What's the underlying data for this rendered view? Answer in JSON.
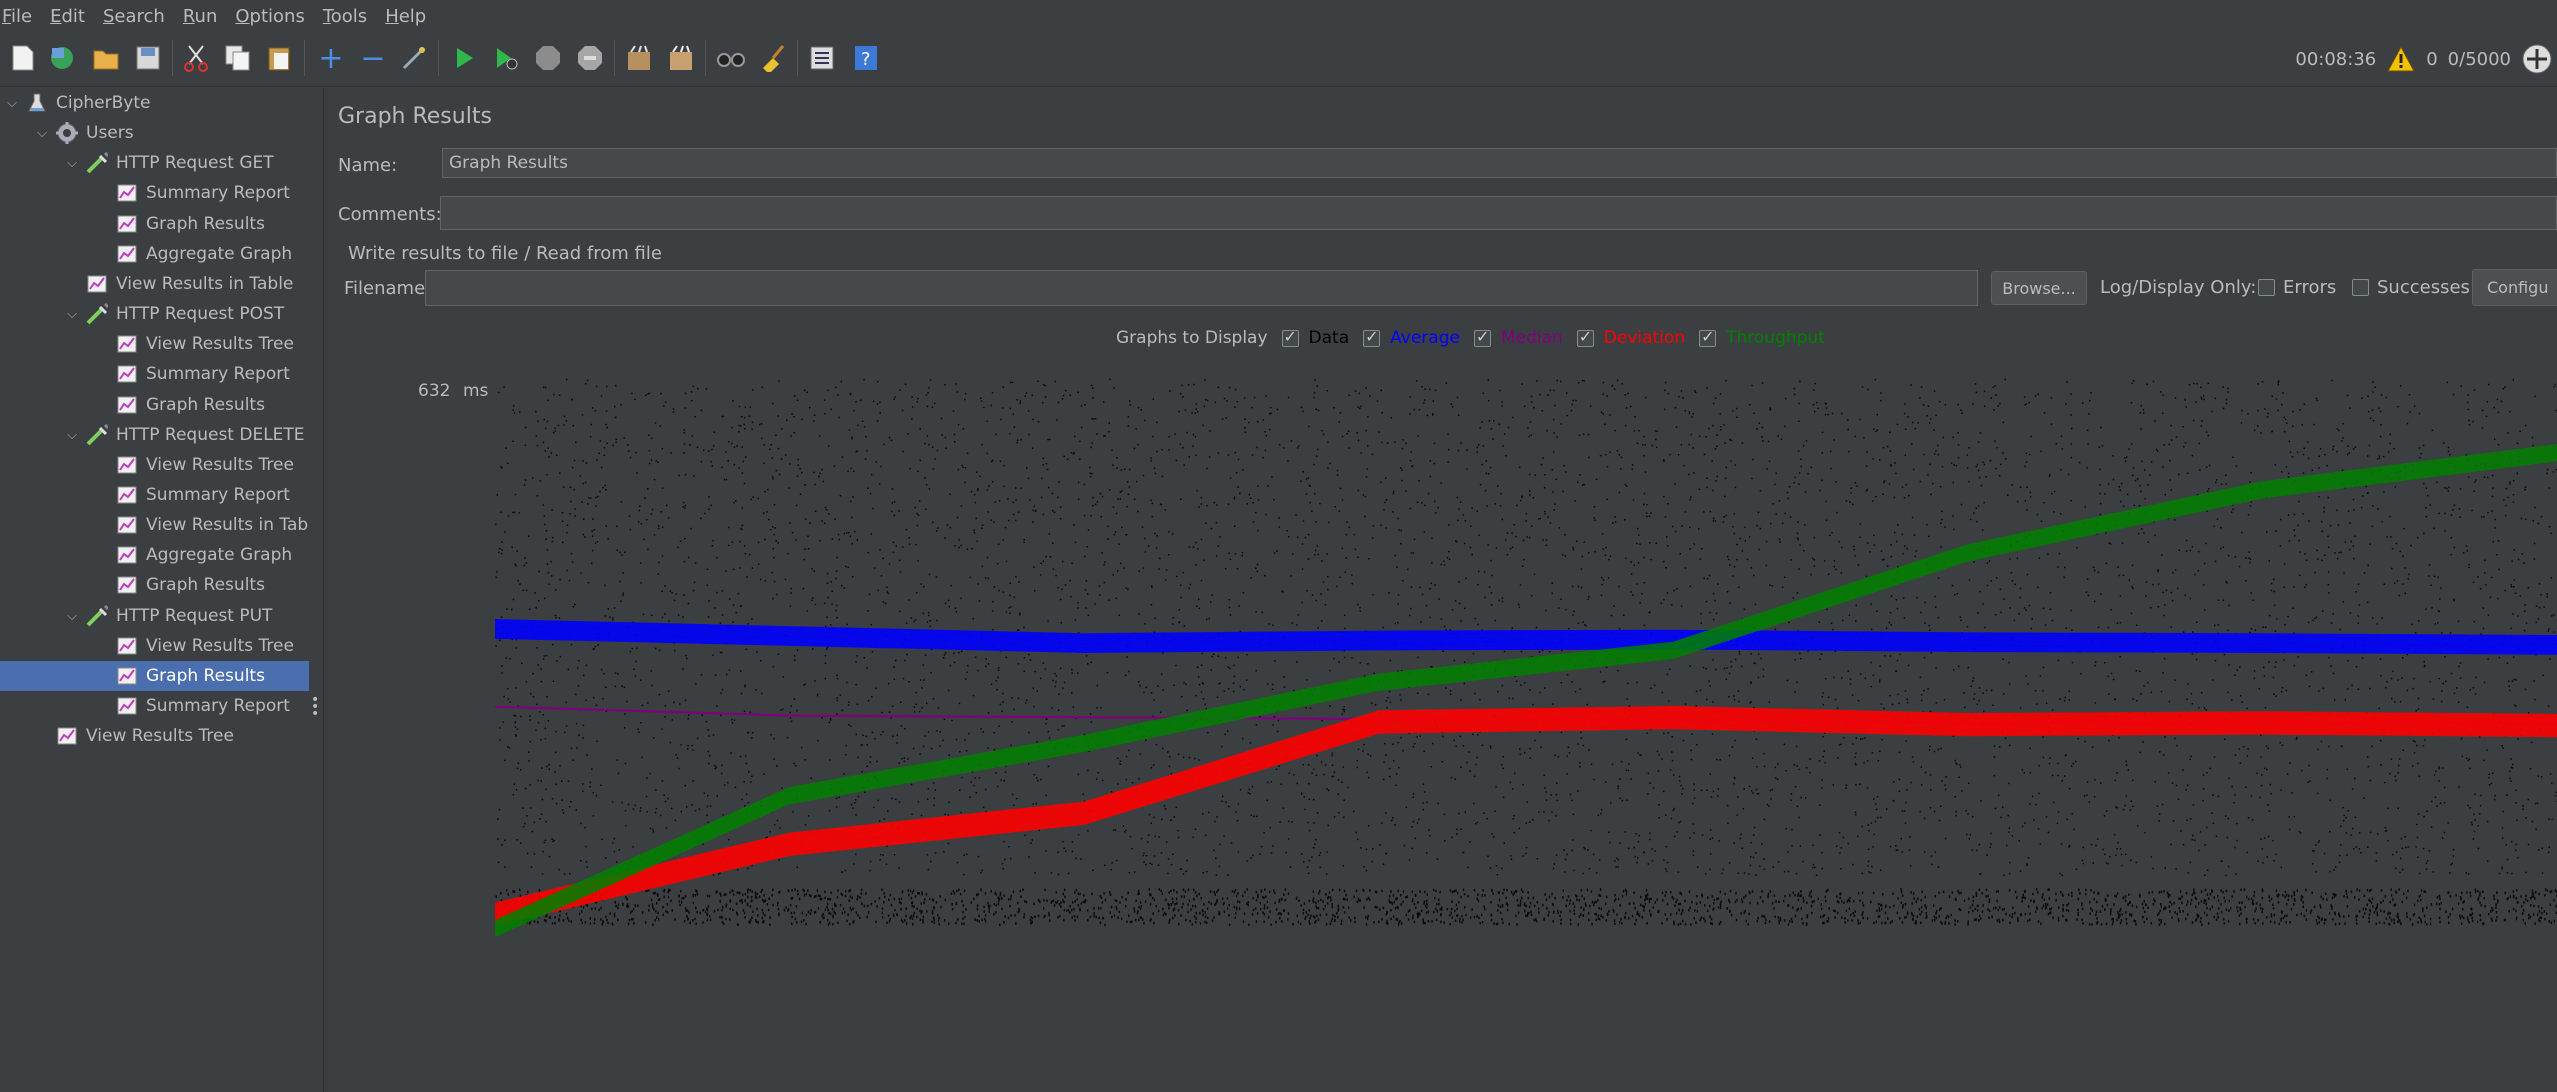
{
  "menu": [
    "File",
    "Edit",
    "Search",
    "Run",
    "Options",
    "Tools",
    "Help"
  ],
  "toolbar": {
    "elapsed": "00:08:36",
    "error_count": "0",
    "threads": "0/5000"
  },
  "tree": [
    {
      "label": "CipherByte",
      "icon": "test-plan-icon",
      "expanded": true
    },
    {
      "label": "Users",
      "icon": "thread-group-icon",
      "expanded": true
    },
    {
      "label": "HTTP Request GET",
      "icon": "sampler-icon",
      "expanded": true
    },
    {
      "label": "Summary Report",
      "icon": "listener-icon"
    },
    {
      "label": "Graph Results",
      "icon": "listener-icon"
    },
    {
      "label": "Aggregate Graph",
      "icon": "listener-icon"
    },
    {
      "label": "View Results in Table",
      "icon": "listener-icon"
    },
    {
      "label": "HTTP Request POST",
      "icon": "sampler-icon",
      "expanded": true
    },
    {
      "label": "View Results Tree",
      "icon": "listener-icon"
    },
    {
      "label": "Summary Report",
      "icon": "listener-icon"
    },
    {
      "label": "Graph Results",
      "icon": "listener-icon"
    },
    {
      "label": "HTTP Request DELETE",
      "icon": "sampler-icon",
      "expanded": true
    },
    {
      "label": "View Results Tree",
      "icon": "listener-icon"
    },
    {
      "label": "Summary Report",
      "icon": "listener-icon"
    },
    {
      "label": "View Results in Table",
      "icon": "listener-icon"
    },
    {
      "label": "Aggregate Graph",
      "icon": "listener-icon"
    },
    {
      "label": "Graph Results",
      "icon": "listener-icon"
    },
    {
      "label": "HTTP Request PUT",
      "icon": "sampler-icon",
      "expanded": true
    },
    {
      "label": "View Results Tree",
      "icon": "listener-icon"
    },
    {
      "label": "Graph Results",
      "icon": "listener-icon",
      "selected": true
    },
    {
      "label": "Summary Report",
      "icon": "listener-icon"
    },
    {
      "label": "View Results Tree",
      "icon": "listener-icon"
    }
  ],
  "panel": {
    "title": "Graph Results",
    "name_label": "Name:",
    "name_value": "Graph Results",
    "comments_label": "Comments:",
    "comments_value": "",
    "file_section": "Write results to file / Read from file",
    "filename_label": "Filename",
    "filename_value": "",
    "browse": "Browse...",
    "log_only": "Log/Display Only:",
    "errors": "Errors",
    "successes": "Successes",
    "configure": "Configu",
    "graphs_to_display": "Graphs to Display",
    "legend": [
      {
        "label": "Data",
        "color": "#000000",
        "checked": true
      },
      {
        "label": "Average",
        "color": "#0000ff",
        "checked": true
      },
      {
        "label": "Median",
        "color": "#800080",
        "checked": true
      },
      {
        "label": "Deviation",
        "color": "#ff0000",
        "checked": true
      },
      {
        "label": "Throughput",
        "color": "#008000",
        "checked": true
      }
    ],
    "y_max": "632",
    "y_unit": "ms"
  },
  "chart_data": {
    "type": "scatter",
    "title": "",
    "xlabel": "",
    "ylabel": "ms",
    "ylim": [
      0,
      632
    ],
    "series": [
      {
        "name": "Data",
        "color": "#000000",
        "values": []
      },
      {
        "name": "Average",
        "color": "#0000ff",
        "values": [
          338,
          330,
          322,
          325,
          326,
          323,
          322,
          320
        ]
      },
      {
        "name": "Median",
        "color": "#800080",
        "values": [
          250,
          240,
          238,
          236,
          234,
          232,
          232,
          231
        ]
      },
      {
        "name": "Deviation",
        "color": "#ff0000",
        "values": [
          16,
          95,
          130,
          233,
          238,
          230,
          232,
          229
        ]
      },
      {
        "name": "Throughput",
        "color": "#008000",
        "values": [
          0,
          150,
          209,
          278,
          314,
          424,
          495,
          537
        ]
      }
    ]
  }
}
